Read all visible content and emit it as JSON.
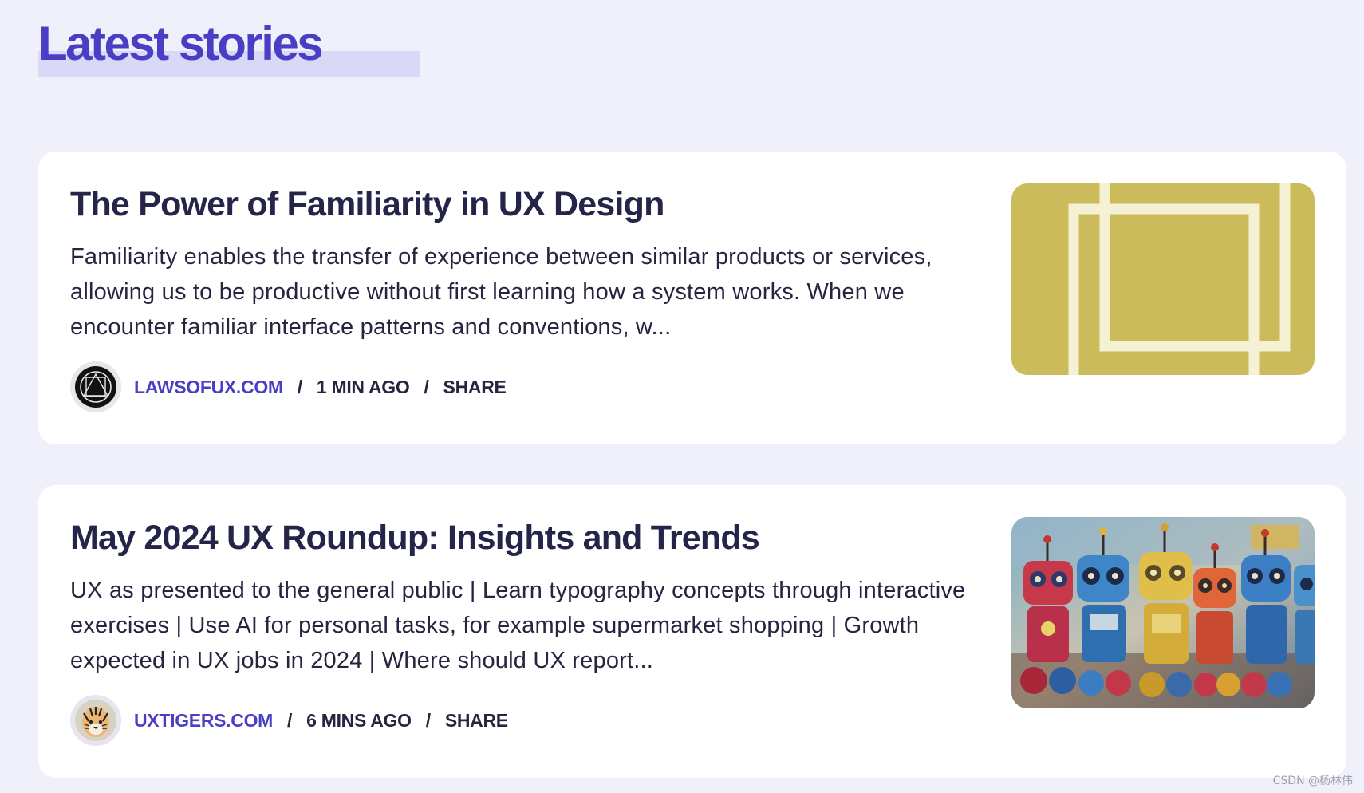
{
  "page": {
    "title": "Latest stories",
    "accent_color": "#4a3fc4",
    "highlight_color": "#d9d9f7",
    "background_color": "#f0f0fa"
  },
  "stories": [
    {
      "title": "The Power of Familiarity in UX Design",
      "excerpt": "Familiarity enables the transfer of experience between similar products or services, allowing us to be productive without first learning how a system works. When we encounter familiar interface patterns and conventions, w...",
      "source": "LAWSOFUX.COM",
      "time": "1 MIN AGO",
      "share_label": "SHARE",
      "separator": "/",
      "avatar_icon": "laws-of-ux-logo-icon",
      "thumbnail": "yellow-square-frames-illustration"
    },
    {
      "title": "May 2024 UX Roundup: Insights and Trends",
      "excerpt": "UX as presented to the general public | Learn typography concepts through interactive exercises | Use AI for personal tasks, for example supermarket shopping | Growth expected in UX jobs in 2024 | Where should UX report...",
      "source": "UXTIGERS.COM",
      "time": "6 MINS AGO",
      "share_label": "SHARE",
      "separator": "/",
      "avatar_icon": "tiger-logo-icon",
      "thumbnail": "colorful-robots-painting"
    }
  ],
  "watermark": "CSDN @杨林伟"
}
